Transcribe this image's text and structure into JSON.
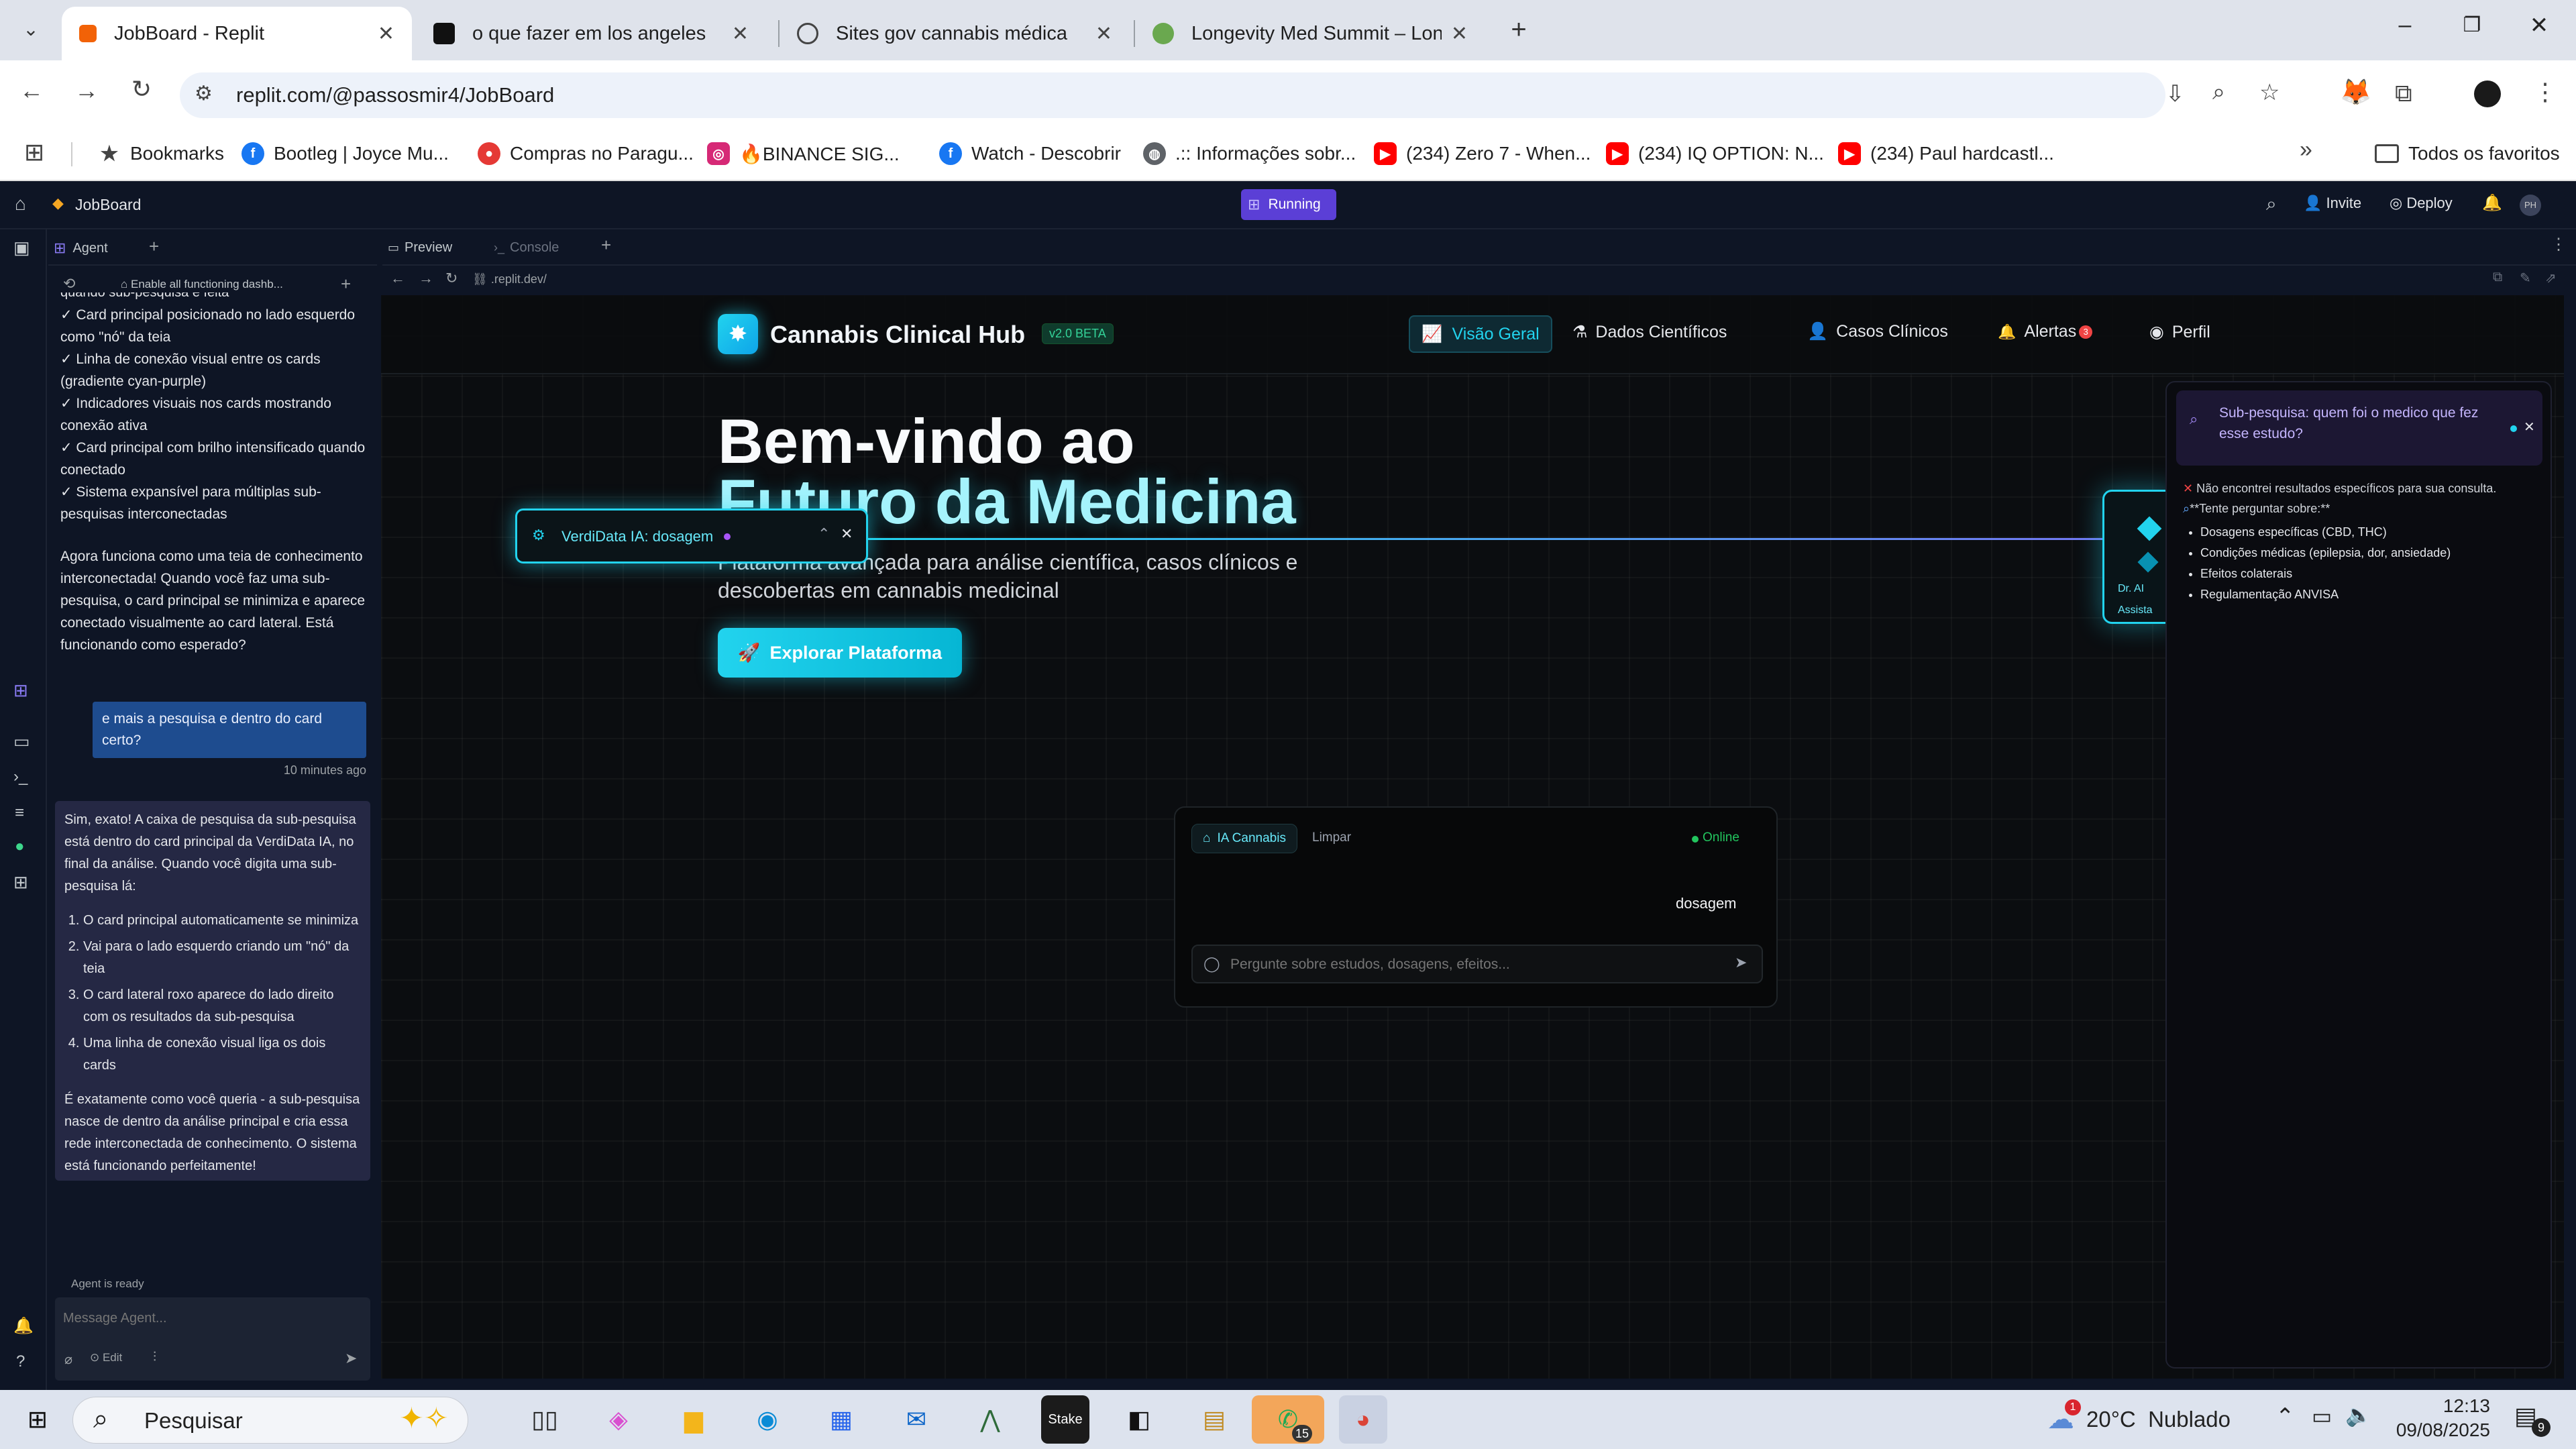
{
  "browser": {
    "tabs": [
      {
        "title": "JobBoard - Replit",
        "active": true,
        "fav_color": "#f26207"
      },
      {
        "title": "o que fazer em los angeles",
        "active": false,
        "fav_color": "#111111"
      },
      {
        "title": "Sites gov cannabis médica",
        "active": false,
        "fav_color": "#444444"
      },
      {
        "title": "Longevity Med Summit – Longe",
        "active": false,
        "fav_color": "#6aa84f"
      }
    ],
    "url": "replit.com/@passosmir4/JobBoard",
    "bookmarks": [
      {
        "label": "Bookmarks",
        "icon": "star-icon",
        "color": "#5f6368"
      },
      {
        "label": "Bootleg | Joyce Mu...",
        "icon": "facebook-icon",
        "color": "#1877f2"
      },
      {
        "label": "Compras no Paragu...",
        "icon": "map-pin-icon",
        "color": "#e53935"
      },
      {
        "label": "🔥BINANCE SIG...",
        "icon": "instagram-icon",
        "color": "#d62976"
      },
      {
        "label": "Watch - Descobrir",
        "icon": "facebook-icon",
        "color": "#1877f2"
      },
      {
        "label": ".:: Informações sobr...",
        "icon": "globe-icon",
        "color": "#5f6368"
      },
      {
        "label": "(234) Zero 7 - When...",
        "icon": "youtube-icon",
        "color": "#ff0000"
      },
      {
        "label": "(234) IQ OPTION: N...",
        "icon": "youtube-icon",
        "color": "#ff0000"
      },
      {
        "label": "(234) Paul hardcastl...",
        "icon": "youtube-icon",
        "color": "#ff0000"
      }
    ],
    "all_bookmarks": "Todos os favoritos"
  },
  "replit": {
    "project": "JobBoard",
    "status": "Running",
    "invite": "Invite",
    "deploy": "Deploy",
    "avatar": "PH",
    "agent_tab": "Agent",
    "history_title": "Enable all functioning dashb...",
    "preview_tab": "Preview",
    "console_tab": "Console",
    "preview_url": ".replit.dev/",
    "chat_top": [
      "quando sub-pesquisa é feita",
      "✓ Card principal posicionado no lado esquerdo como \"nó\" da teia",
      "✓ Linha de conexão visual entre os cards (gradiente cyan-purple)",
      "✓ Indicadores visuais nos cards mostrando conexão ativa",
      "✓ Card principal com brilho intensificado quando conectado",
      "✓ Sistema expansível para múltiplas sub-pesquisas interconectadas"
    ],
    "chat_para": "Agora funciona como uma teia de conhecimento interconectada! Quando você faz uma sub-pesquisa, o card principal se minimiza e aparece conectado visualmente ao card lateral. Está funcionando como esperado?",
    "user_msg": "e mais a pesquisa e dentro do card certo?",
    "user_time": "10 minutes ago",
    "reply_intro": "Sim, exato! A caixa de pesquisa da sub-pesquisa está dentro do card principal da VerdiData IA, no final da análise. Quando você digita uma sub-pesquisa lá:",
    "reply_steps": [
      "O card principal automaticamente se minimiza",
      "Vai para o lado esquerdo criando um \"nó\" da teia",
      "O card lateral roxo aparece do lado direito com os resultados da sub-pesquisa",
      "Uma linha de conexão visual liga os dois cards"
    ],
    "reply_outro": "É exatamente como você queria - a sub-pesquisa nasce de dentro da análise principal e cria essa rede interconectada de conhecimento. O sistema está funcionando perfeitamente!",
    "agent_status": "Agent is ready",
    "message_placeholder": "Message Agent...",
    "edit": "Edit"
  },
  "app": {
    "brand": "Cannabis Clinical Hub",
    "version": "v2.0 BETA",
    "nav": [
      {
        "label": "Visão Geral",
        "icon": "chart-icon",
        "active": true
      },
      {
        "label": "Dados Científicos",
        "icon": "flask-icon",
        "active": false
      },
      {
        "label": "Casos Clínicos",
        "icon": "user-icon",
        "active": false
      },
      {
        "label": "Alertas",
        "icon": "bell-icon",
        "active": false,
        "badge": "3"
      },
      {
        "label": "Perfil",
        "icon": "profile-icon",
        "active": false
      }
    ],
    "hero_line1": "Bem-vindo ao",
    "hero_line2": "Futuro da Medicina",
    "hero_sub1": "Plataforma avançada para análise científica, casos clínicos e",
    "hero_sub2": "descobertas em cannabis medicinal",
    "cta": "Explorar Plataforma",
    "mini_card": "VerdiData IA: dosagem",
    "node_label1": "Dr. AI",
    "node_label2": "Assista",
    "chat_tag": "IA Cannabis",
    "chat_clear": "Limpar",
    "chat_status": "Online",
    "chat_bubble": "dosagem",
    "chat_placeholder": "Pergunte sobre estudos, dosagens, efeitos...",
    "sub_title": "Sub-pesquisa: quem foi o medico que fez esse estudo?",
    "sub_notfound": "Não encontrei resultados específicos para sua consulta.",
    "sub_try": "**Tente perguntar sobre:**",
    "sub_items": [
      "Dosagens específicas (CBD, THC)",
      "Condições médicas (epilepsia, dor, ansiedade)",
      "Efeitos colaterais",
      "Regulamentação ANVISA"
    ]
  },
  "taskbar": {
    "search": "Pesquisar",
    "weather": "20°C  Nublado",
    "weather_badge": "1",
    "time": "12:13",
    "date": "09/08/2025",
    "whatsapp_badge": "15",
    "notif_badge": "9"
  },
  "colors": {
    "accent": "#22d3ee",
    "purple": "#8b5cf6",
    "replit_bg": "#0e1525"
  }
}
